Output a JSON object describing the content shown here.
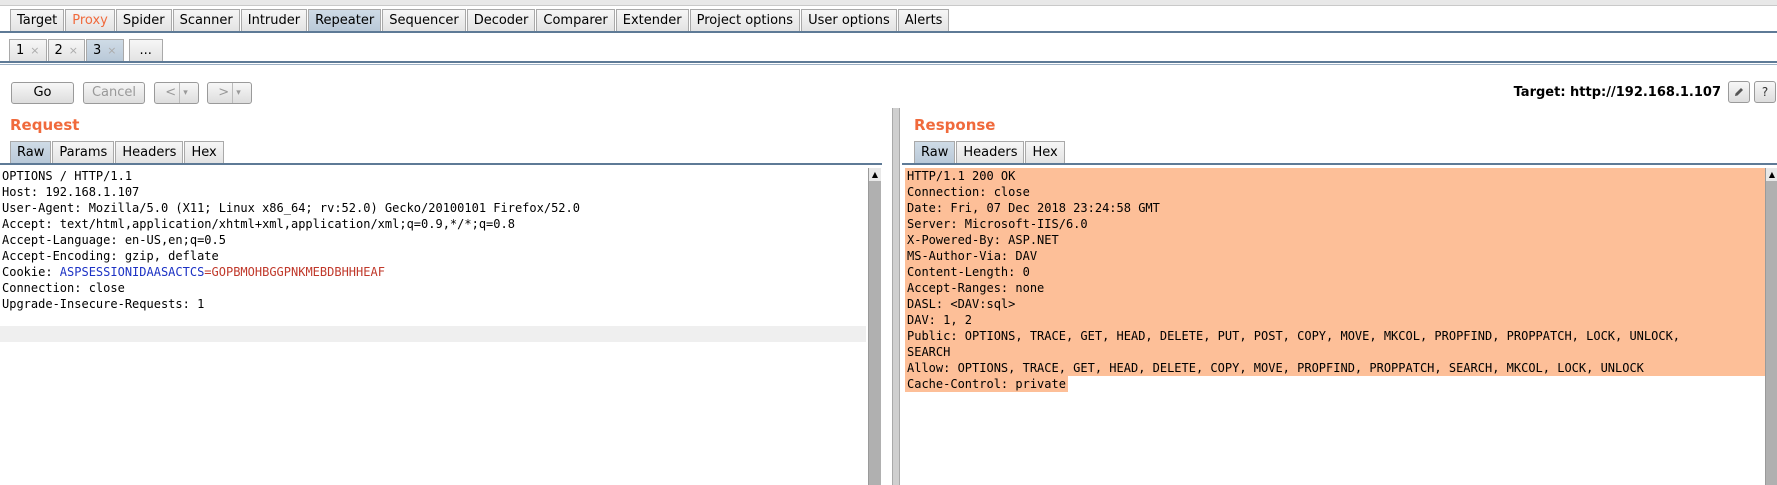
{
  "main_tabs": [
    {
      "label": "Target",
      "active": false
    },
    {
      "label": "Proxy",
      "active": false,
      "highlight": true
    },
    {
      "label": "Spider",
      "active": false
    },
    {
      "label": "Scanner",
      "active": false
    },
    {
      "label": "Intruder",
      "active": false
    },
    {
      "label": "Repeater",
      "active": true
    },
    {
      "label": "Sequencer",
      "active": false
    },
    {
      "label": "Decoder",
      "active": false
    },
    {
      "label": "Comparer",
      "active": false
    },
    {
      "label": "Extender",
      "active": false
    },
    {
      "label": "Project options",
      "active": false
    },
    {
      "label": "User options",
      "active": false
    },
    {
      "label": "Alerts",
      "active": false
    }
  ],
  "repeater_tabs": [
    {
      "label": "1",
      "close": "×"
    },
    {
      "label": "2",
      "close": "×"
    },
    {
      "label": "3",
      "close": "×",
      "active": true
    }
  ],
  "more_tabs_label": "...",
  "toolbar": {
    "go": "Go",
    "cancel": "Cancel",
    "back": "<",
    "forward": ">",
    "caret": "▾",
    "target": "Target: http://192.168.1.107",
    "edit_icon": "pencil-icon",
    "help": "?"
  },
  "request": {
    "title": "Request",
    "tabs": [
      "Raw",
      "Params",
      "Headers",
      "Hex"
    ],
    "lines": [
      "OPTIONS / HTTP/1.1",
      "Host: 192.168.1.107",
      "User-Agent: Mozilla/5.0 (X11; Linux x86_64; rv:52.0) Gecko/20100101 Firefox/52.0",
      "Accept: text/html,application/xhtml+xml,application/xml;q=0.9,*/*;q=0.8",
      "Accept-Language: en-US,en;q=0.5",
      "Accept-Encoding: gzip, deflate"
    ],
    "cookie": {
      "prefix": "Cookie: ",
      "name": "ASPSESSIONIDAASACTCS",
      "eq": "=",
      "value": "GOPBMOHBGGPNKMEBDBHHHEAF"
    },
    "lines_after": [
      "Connection: close",
      "Upgrade-Insecure-Requests: 1"
    ]
  },
  "response": {
    "title": "Response",
    "tabs": [
      "Raw",
      "Headers",
      "Hex"
    ],
    "lines": [
      "HTTP/1.1 200 OK",
      "Connection: close",
      "Date: Fri, 07 Dec 2018 23:24:58 GMT",
      "Server: Microsoft-IIS/6.0",
      "X-Powered-By: ASP.NET",
      "MS-Author-Via: DAV",
      "Content-Length: 0",
      "Accept-Ranges: none",
      "DASL: <DAV:sql>",
      "DAV: 1, 2",
      "Public: OPTIONS, TRACE, GET, HEAD, DELETE, PUT, POST, COPY, MOVE, MKCOL, PROPFIND, PROPPATCH, LOCK, UNLOCK,",
      "SEARCH",
      "Allow: OPTIONS, TRACE, GET, HEAD, DELETE, COPY, MOVE, PROPFIND, PROPPATCH, SEARCH, MKCOL, LOCK, UNLOCK"
    ],
    "last_line": "Cache-Control: private"
  },
  "colors": {
    "accent": "#f06a3c",
    "selection": "#fdbf98",
    "tab_active": "#b9c9d8",
    "cookie_name": "#1c32c4",
    "cookie_value": "#c0392b"
  }
}
